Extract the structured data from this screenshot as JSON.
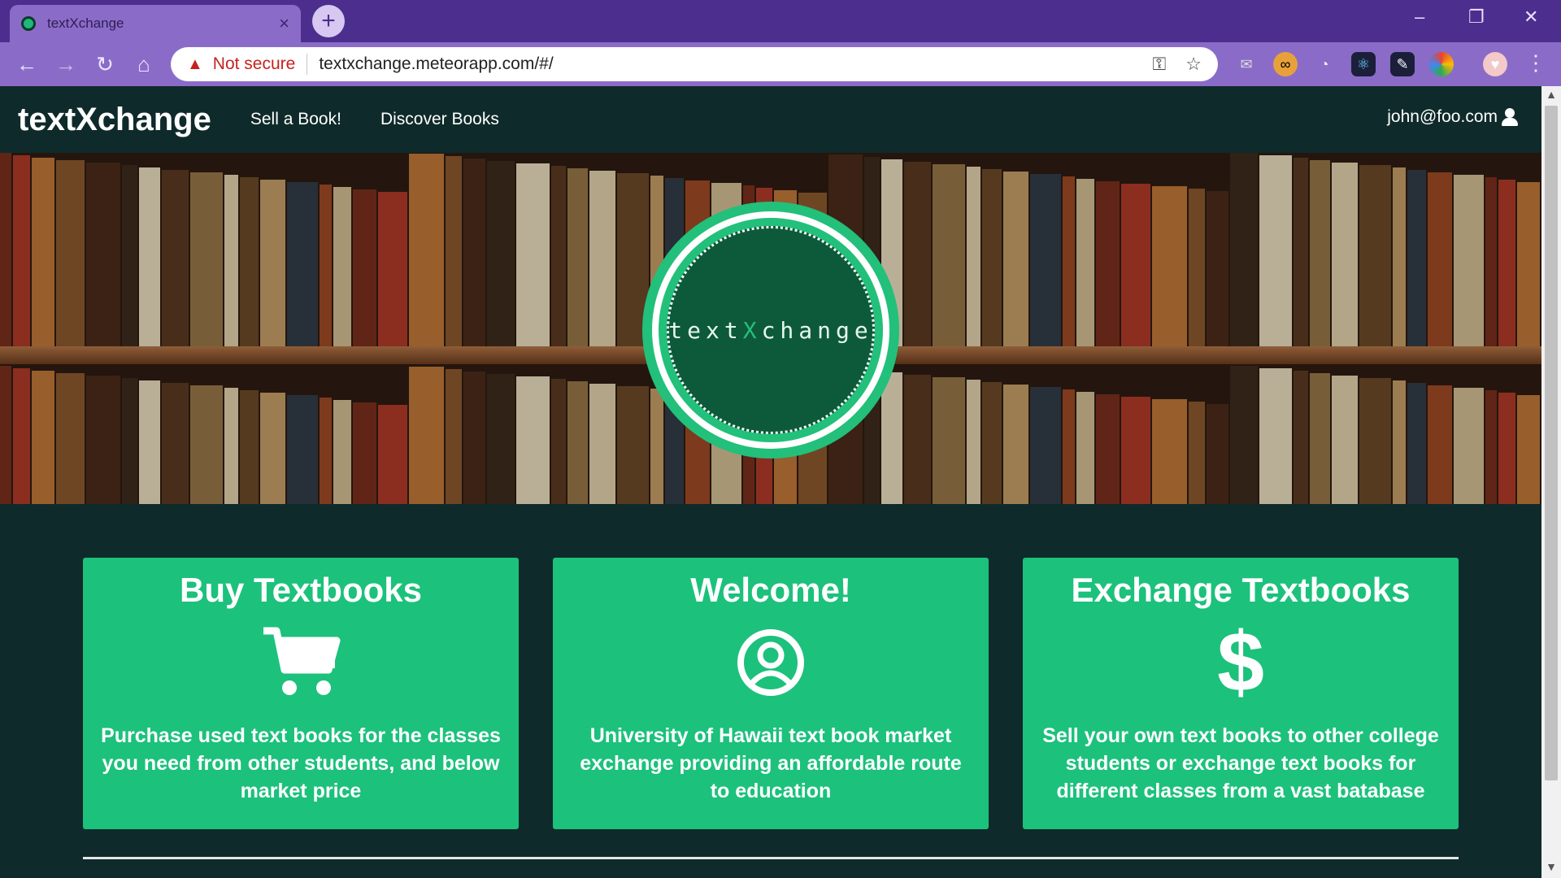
{
  "browser": {
    "tab_title": "textXchange",
    "not_secure": "Not secure",
    "url": "textxchange.meteorapp.com/#/"
  },
  "navbar": {
    "brand": "textXchange",
    "links": [
      "Sell a Book!",
      "Discover Books"
    ],
    "user": "john@foo.com"
  },
  "hero": {
    "logo_prefix": "text",
    "logo_x": "X",
    "logo_suffix": "change"
  },
  "cards": [
    {
      "title": "Buy Textbooks",
      "icon": "cart-icon",
      "text": "Purchase used text books for the classes you need from other students, and below market price"
    },
    {
      "title": "Welcome!",
      "icon": "user-circle-icon",
      "text": "University of Hawaii text book market exchange providing an affordable route to education"
    },
    {
      "title": "Exchange Textbooks",
      "icon": "dollar-icon",
      "text": "Sell your own text books to other college students or exchange text books for different classes from a vast batabase"
    }
  ],
  "colors": {
    "accent": "#1cc17c",
    "page_bg": "#0f2a2a",
    "chrome": "#4b2e8e"
  }
}
